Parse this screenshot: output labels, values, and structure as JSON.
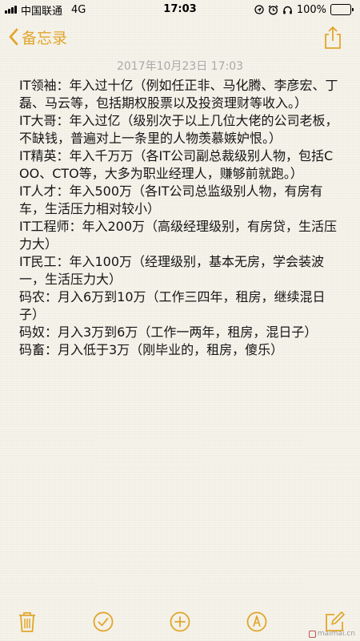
{
  "status_bar": {
    "carrier": "中国联通",
    "network": "4G",
    "time": "17:03",
    "battery_percent": "100%",
    "battery_level": 1.0
  },
  "nav": {
    "back_label": "备忘录",
    "accent_color": "#e1a62c"
  },
  "note": {
    "date": "2017年10月23日 17:03",
    "paragraphs": [
      "IT领袖：年入过十亿（例如任正非、马化腾、李彦宏、丁磊、马云等，包括期权股票以及投资理财等收入。）",
      "IT大哥：年入过亿（级别次于以上几位大佬的公司老板，不缺钱，普遍对上一条里的人物羡慕嫉妒恨。）",
      "IT精英：年入千万万（各IT公司副总裁级别人物，包括COO、CTO等，大多为职业经理人，赚够前就跑。）",
      "IT人才：年入500万（各IT公司总监级别人物，有房有车，生活压力相对较小）",
      "IT工程师：年入200万（高级经理级别，有房贷，生活压力大）",
      "IT民工：年入100万（经理级别，基本无房，学会装波一，生活压力大）",
      "码农：月入6万到10万（工作三四年，租房，继续混日子）",
      "码奴：月入3万到6万（工作一两年，租房，混日子）",
      "码畜：月入低于3万（刚毕业的，租房，傻乐）"
    ]
  },
  "watermark": {
    "text": "maimai.cn"
  },
  "toolbar": {
    "icons": [
      "trash-icon",
      "checklist-icon",
      "add-icon",
      "markup-icon",
      "compose-icon"
    ]
  }
}
